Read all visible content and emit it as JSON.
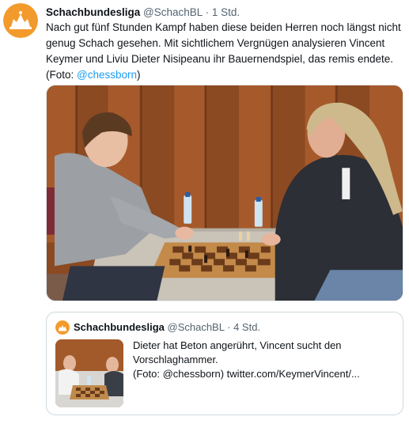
{
  "tweet": {
    "author_name": "Schachbundesliga",
    "author_handle": "@SchachBL",
    "separator": "·",
    "time": "1 Std.",
    "text_before_link": "Nach gut fünf Stunden Kampf haben diese beiden Herren noch längst nicht genug Schach gesehen. Mit sichtlichem Vergnügen analysieren Vincent Keymer und Liviu Dieter Nisipeanu ihr Bauernendspiel, das remis endete. (Foto: ",
    "link": "@chessborn",
    "text_after_link": ")"
  },
  "quoted": {
    "author_name": "Schachbundesliga",
    "author_handle": "@SchachBL",
    "separator": "·",
    "time": "4 Std.",
    "line1": "Dieter hat Beton angerührt, Vincent sucht den",
    "line2": "Vorschlaghammer.",
    "line3": "(Foto: @chessborn)  twitter.com/KeymerVincent/..."
  },
  "colors": {
    "brand_orange": "#f39a2c",
    "link_blue": "#1d9bf0",
    "secondary_text": "#536471",
    "border": "#cfd9de"
  },
  "icons": {
    "avatar": "schachbundesliga-logo-icon"
  }
}
